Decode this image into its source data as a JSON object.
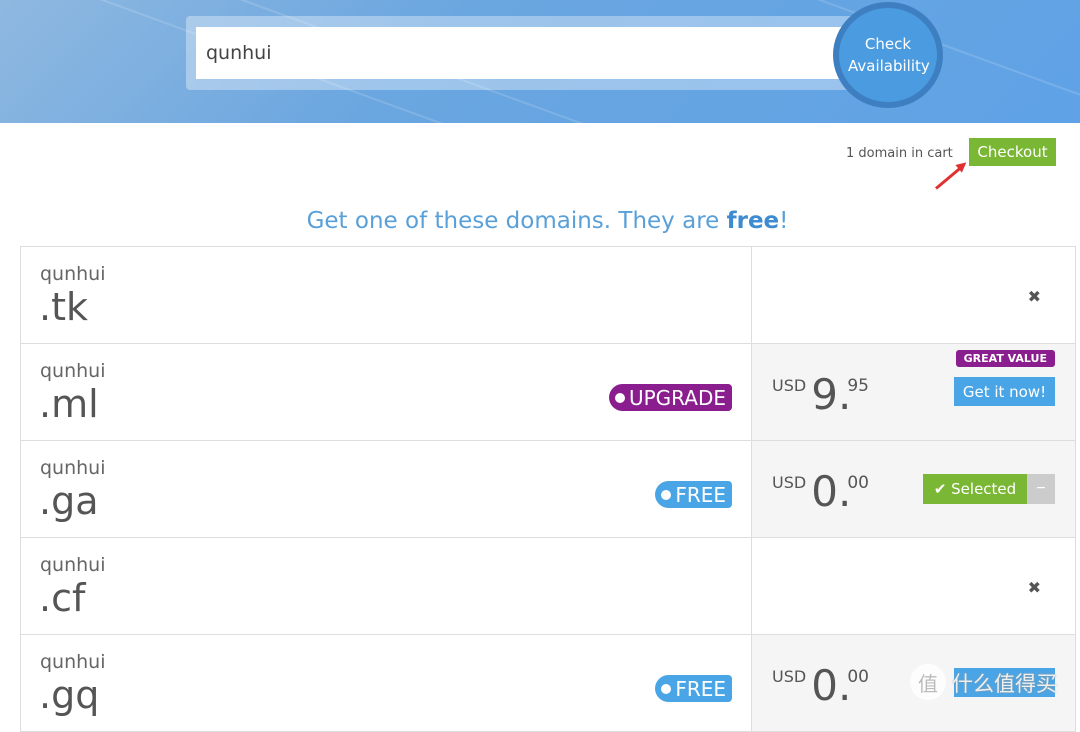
{
  "search": {
    "value": "qunhui",
    "button": "Check Availability"
  },
  "cart": {
    "info": "1 domain in cart",
    "checkout": "Checkout"
  },
  "headline": {
    "pre": "Get one of these domains. They are ",
    "bold": "free",
    "post": "!"
  },
  "rows": [
    {
      "name": "qunhui",
      "tld": ".tk",
      "status": "unavailable",
      "remove": "✖"
    },
    {
      "name": "qunhui",
      "tld": ".ml",
      "badge": "UPGRADE",
      "currency": "USD",
      "price_int": "9.",
      "price_dec": "95",
      "tag": "GREAT VALUE",
      "action": "Get it now!"
    },
    {
      "name": "qunhui",
      "tld": ".ga",
      "badge": "FREE",
      "currency": "USD",
      "price_int": "0.",
      "price_dec": "00",
      "action": "✔ Selected",
      "remove": "−"
    },
    {
      "name": "qunhui",
      "tld": ".cf",
      "status": "unavailable",
      "remove": "✖"
    },
    {
      "name": "qunhui",
      "tld": ".gq",
      "badge": "FREE",
      "currency": "USD",
      "price_int": "0.",
      "price_dec": "00"
    }
  ],
  "watermark": {
    "text": "什么值得买",
    "icon": "值"
  },
  "colors": {
    "accent_blue": "#4aa5e6",
    "green": "#7ab734",
    "purple": "#8a1e8e",
    "arrow": "#e03030"
  }
}
